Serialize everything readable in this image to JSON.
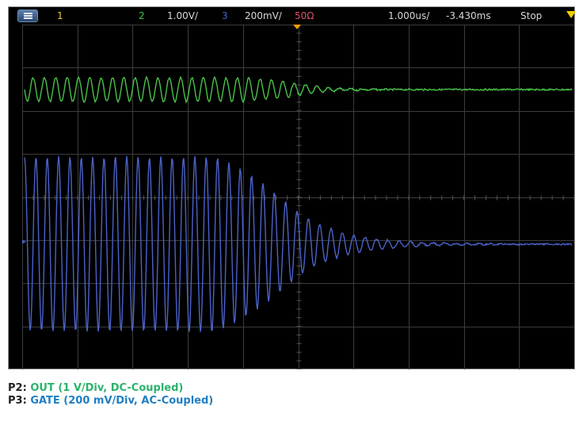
{
  "scope": {
    "header": {
      "ch1_label": "1",
      "ch2_label": "2",
      "ch2_scale": "1.00V/",
      "ch3_label": "3",
      "ch3_scale": "200mV/",
      "ch3_impedance": "50Ω",
      "timebase": "1.000us/",
      "delay": "-3.430ms",
      "run_state": "Stop"
    },
    "icons": [
      "menu-icon",
      "trigger-marker-icon",
      "trigger-position-icon",
      "ch3-ground-marker-icon"
    ],
    "colors": {
      "background": "#000000",
      "grid": "#3c3c3c",
      "ch1": "#e6d23a",
      "ch2": "#49c24a",
      "ch3": "#4b62c8",
      "ch3_impedance": "#e0506a",
      "trigger": "#f0a000"
    },
    "ground_marker_label": "3"
  },
  "traces": {
    "ch2": {
      "name": "OUT",
      "cycles_before_trigger": 24,
      "cycles_after_trigger": 16,
      "amplitude_div_before": 0.5,
      "decay": "fast"
    },
    "ch3": {
      "name": "GATE",
      "cycles_before_trigger": 24,
      "cycles_after_trigger": 16,
      "amplitude_div_before": 3.0,
      "decay": "exponential"
    }
  },
  "legend": [
    {
      "label": "P2:",
      "text": "OUT (1 V/Div, DC-Coupled)",
      "color": "#2bb36b"
    },
    {
      "label": "P3:",
      "text": "GATE (200 mV/Div, AC-Coupled)",
      "color": "#1f7fc4"
    }
  ]
}
